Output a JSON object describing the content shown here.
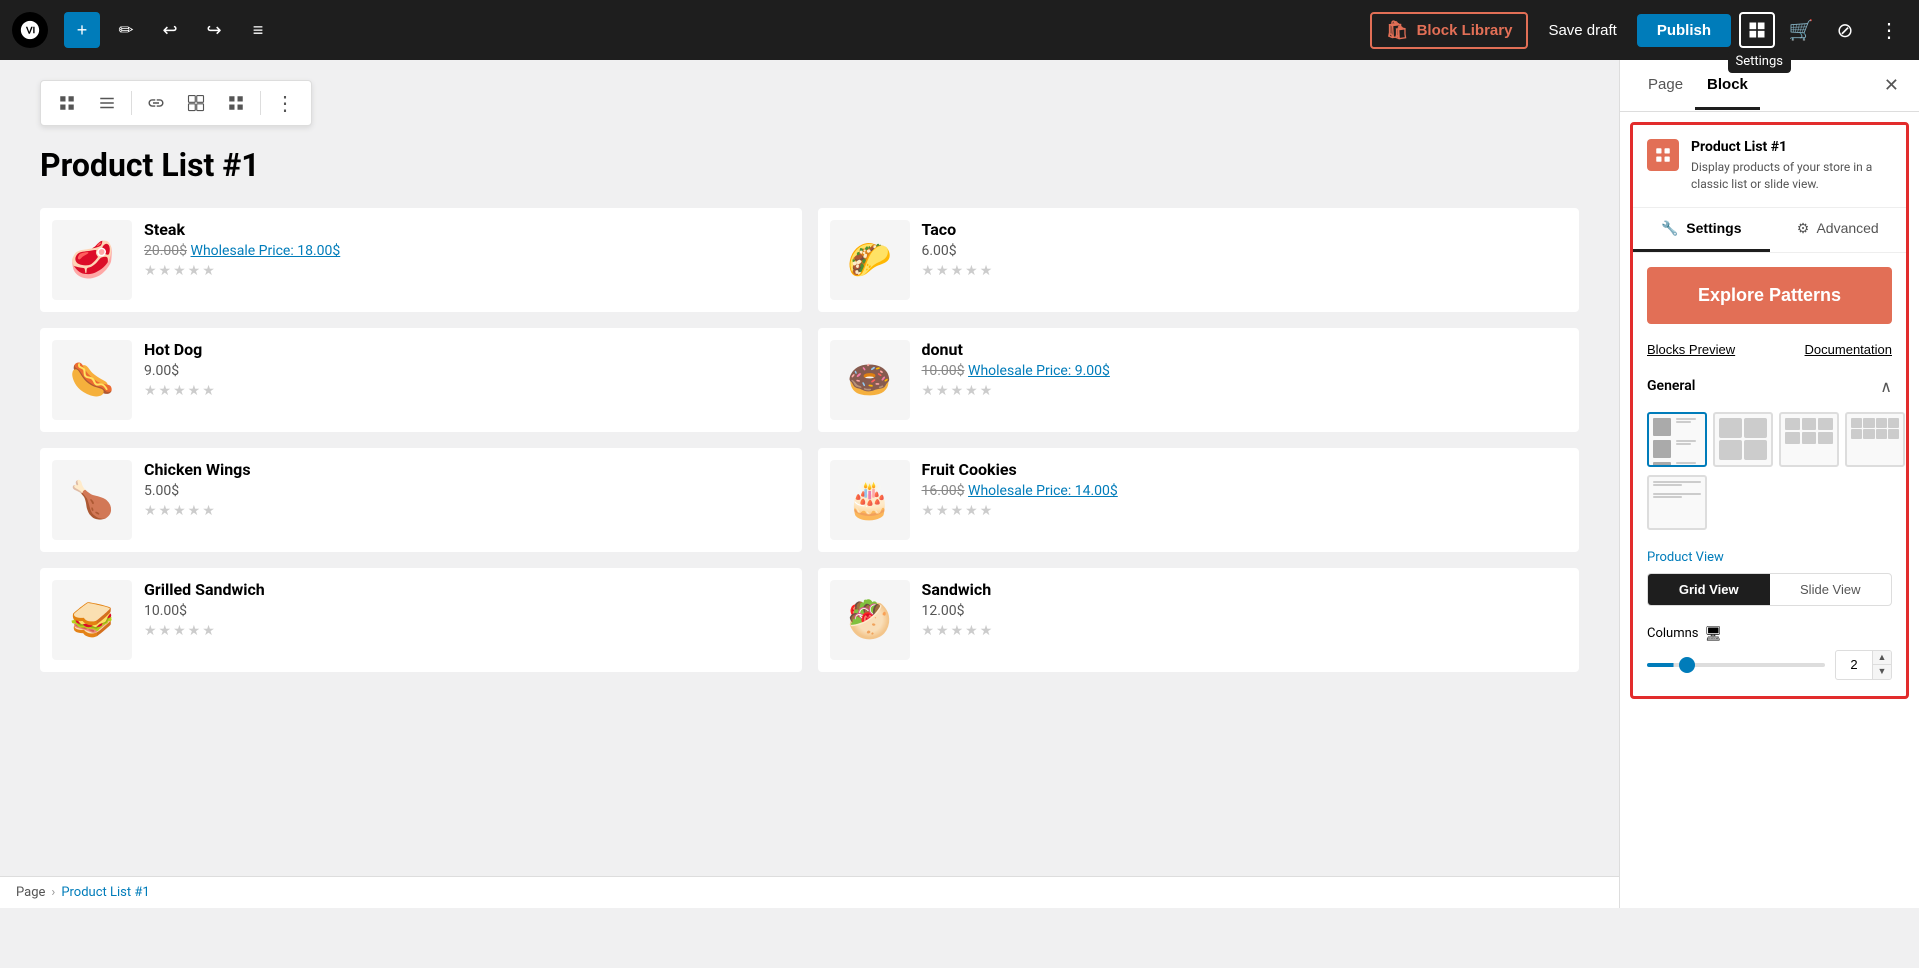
{
  "topbar": {
    "add_label": "+",
    "pencil_label": "✏",
    "undo_label": "↩",
    "redo_label": "↪",
    "list_label": "≡",
    "block_library_label": "Block Library",
    "save_draft_label": "Save draft",
    "publish_label": "Publish",
    "settings_tooltip": "Settings",
    "more_label": "⋮"
  },
  "block_toolbar": {
    "btn1": "▦",
    "btn2": "☰",
    "btn3": "⊞",
    "btn4": "⊟",
    "btn5": "⊞",
    "btn6": "⋮"
  },
  "editor": {
    "title": "Product List #1",
    "products": [
      {
        "name": "Steak",
        "price_original": "20.00$",
        "price_wholesale": "Wholesale Price: 18.00$",
        "has_wholesale": true,
        "emoji": "🥩"
      },
      {
        "name": "Taco",
        "price_original": "6.00$",
        "has_wholesale": false,
        "emoji": "🌮"
      },
      {
        "name": "Hot Dog",
        "price_original": "9.00$",
        "has_wholesale": false,
        "emoji": "🌭"
      },
      {
        "name": "donut",
        "price_original": "10.00$",
        "price_wholesale": "Wholesale Price: 9.00$",
        "has_wholesale": true,
        "emoji": "🍩"
      },
      {
        "name": "Chicken Wings",
        "price_original": "5.00$",
        "has_wholesale": false,
        "emoji": "🍗"
      },
      {
        "name": "Fruit Cookies",
        "price_original": "16.00$",
        "price_wholesale": "Wholesale Price: 14.00$",
        "has_wholesale": true,
        "emoji": "🎂"
      },
      {
        "name": "Grilled Sandwich",
        "price_original": "10.00$",
        "has_wholesale": false,
        "emoji": "🥪"
      },
      {
        "name": "Sandwich",
        "price_original": "12.00$",
        "has_wholesale": false,
        "emoji": "🥙"
      }
    ]
  },
  "sidebar": {
    "tab_page": "Page",
    "tab_block": "Block",
    "close_label": "✕",
    "block_icon": "📋",
    "block_name": "Product List #1",
    "block_desc": "Display products of your store in a classic list or slide view.",
    "tab_settings": "Settings",
    "tab_advanced": "Advanced",
    "explore_patterns_label": "Explore Patterns",
    "blocks_preview_label": "Blocks Preview",
    "documentation_label": "Documentation",
    "general_label": "General",
    "product_view_label": "Product View",
    "grid_view_label": "Grid View",
    "slide_view_label": "Slide View",
    "columns_label": "Columns",
    "columns_value": "2"
  },
  "breadcrumb": {
    "page_label": "Page",
    "separator": "›",
    "block_label": "Product List #1"
  },
  "colors": {
    "accent_blue": "#007cba",
    "accent_orange": "#e26f56",
    "border_red": "#e22c2c",
    "dark": "#1e1e1e"
  }
}
